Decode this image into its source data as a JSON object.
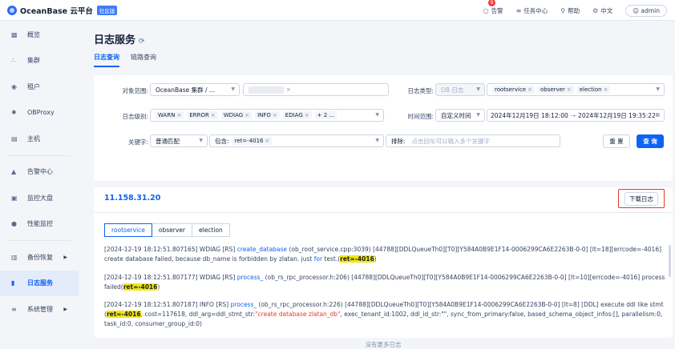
{
  "brand": {
    "name": "OceanBase 云平台",
    "edition": "社区版"
  },
  "top": {
    "alerts": "告警",
    "alert_badge": "9",
    "tasks": "任务中心",
    "help": "帮助",
    "lang": "中文",
    "user": "admin"
  },
  "sidebar": {
    "items": [
      {
        "label": "概览",
        "icon": "bar-chart-icon"
      },
      {
        "label": "集群",
        "icon": "cluster-icon"
      },
      {
        "label": "租户",
        "icon": "tenant-icon"
      },
      {
        "label": "OBProxy",
        "icon": "proxy-icon"
      },
      {
        "label": "主机",
        "icon": "host-icon"
      },
      {
        "label": "告警中心",
        "icon": "bell-icon"
      },
      {
        "label": "监控大盘",
        "icon": "dashboard-icon"
      },
      {
        "label": "性能监控",
        "icon": "performance-icon"
      },
      {
        "label": "备份恢复",
        "icon": "backup-icon"
      },
      {
        "label": "日志服务",
        "icon": "log-icon"
      },
      {
        "label": "系统管理",
        "icon": "settings-icon"
      }
    ]
  },
  "page": {
    "title": "日志服务",
    "tabs": [
      "日志查询",
      "链路查询"
    ]
  },
  "filters": {
    "scope_label": "对象范围:",
    "scope_value": "OceanBase 集群 / ...",
    "logtype_label": "日志类型:",
    "logtype_value": "OB 日志",
    "logtype_tags": [
      "rootservice",
      "observer",
      "election"
    ],
    "level_label": "日志级别:",
    "level_tags": [
      "WARN",
      "ERROR",
      "WDIAG",
      "INFO",
      "EDIAG"
    ],
    "level_more": "+ 2 ...",
    "time_label": "时间范围:",
    "time_mode": "自定义时间",
    "time_start": "2024年12月19日 18:12:00",
    "time_end": "2024年12月19日 19:35:22",
    "keyword_label": "关键字:",
    "match_mode": "普通匹配",
    "include_label": "包含:",
    "include_tag": "ret=-4016",
    "exclude_label": "排除:",
    "exclude_placeholder": "点击回车可以输入多个关键字",
    "reset_label": "重 置",
    "query_label": "查 询"
  },
  "result": {
    "host": "11.158.31.20",
    "download_label": "下载日志",
    "segments": [
      "rootservice",
      "observer",
      "election"
    ],
    "logs": [
      {
        "pre": "[2024-12-19 18:12:51.807165] WDIAG [RS] ",
        "fn": "create_database",
        "mid": " (ob_root_service.cpp:3039) [44788][DDLQueueTh0][T0][Y584A0B9E1F14-0006299CA6E2263B-0-0] [lt=18][errcode=-4016] create database failed, because db_name is forbidden by zlatan. just ",
        "fw": "for",
        "post": " test.(",
        "hl": "ret=-4016",
        "tail": ")"
      },
      {
        "pre": "[2024-12-19 18:12:51.807177] WDIAG [RS] ",
        "fn": "process_",
        "mid": " (ob_rs_rpc_processor.h:206) [44788][DDLQueueTh0][T0][Y584A0B9E1F14-0006299CA6E2263B-0-0] [lt=10][errcode=-4016] process failed(",
        "hl": "ret=-4016",
        "tail": ")"
      },
      {
        "pre": "[2024-12-19 18:12:51.807187] INFO [RS] ",
        "fn": "process_",
        "mid": " (ob_rs_rpc_processor.h:226) [44788][DDLQueueTh0][T0][Y584A0B9E1F14-0006299CA6E2263B-0-0] [lt=8] [DDL] execute ddl like stmt(",
        "hl": "ret=-4016",
        "tail": ", cost=117618, ddl_arg=ddl_stmt_str:",
        "str": "\"create database zlatan_db\"",
        "tail2": ", exec_tenant_id:1002, ddl_id_str:\"\", sync_from_primary:false, based_schema_object_infos:[], parallelism:0, task_id:0, consumer_group_id:0)"
      }
    ],
    "no_more": "没有更多日志"
  }
}
